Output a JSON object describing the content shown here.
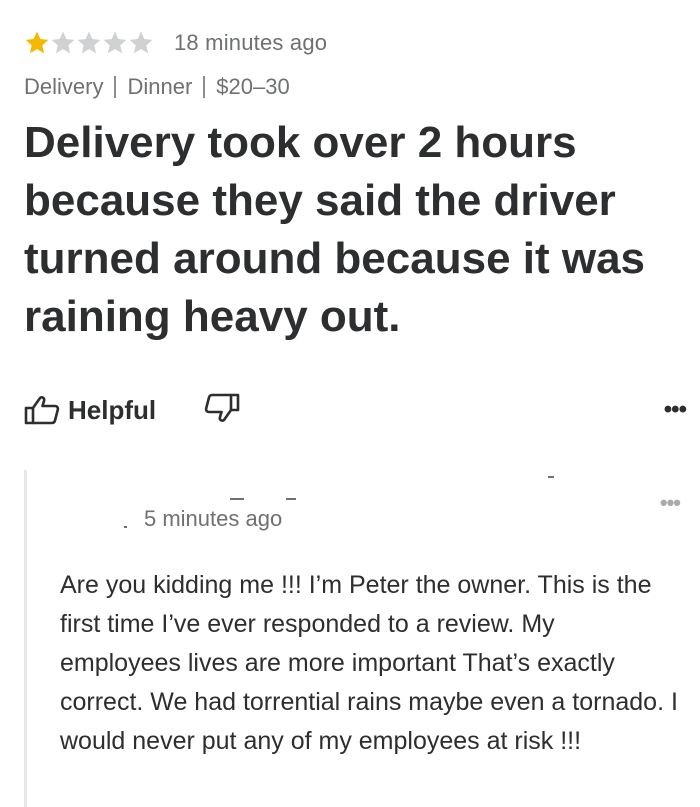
{
  "review": {
    "rating": 1,
    "rating_max": 5,
    "star_filled_color": "#f5b800",
    "star_empty_color": "#d0d1d2",
    "timestamp": "18 minutes ago",
    "tags": [
      "Delivery",
      "Dinner",
      "$20–30"
    ],
    "headline": "Delivery took over 2 hours because they said the driver turned around because it was raining heavy out."
  },
  "actions": {
    "helpful_label": "Helpful",
    "helpful_icon": "thumbs-up-icon",
    "unhelpful_icon": "thumbs-down-icon",
    "more_label": "•••"
  },
  "reply": {
    "timestamp": "5 minutes ago",
    "more_label": "•••",
    "body": "Are you kidding me !!! I’m Peter the owner. This is the first time I’ve ever responded to a review. My employees lives are more important   That’s exactly correct. We had torrential rains maybe even a tornado. I would never put any of my employees at risk !!!"
  }
}
